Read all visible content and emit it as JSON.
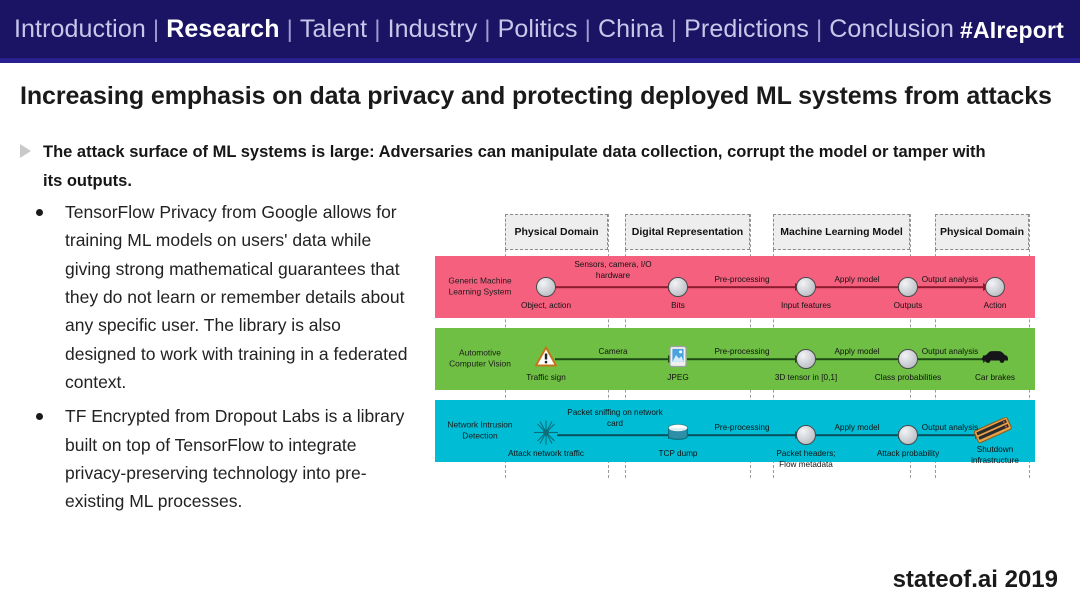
{
  "nav": {
    "items": [
      {
        "label": "Introduction",
        "active": false
      },
      {
        "label": "Research",
        "active": true
      },
      {
        "label": "Talent",
        "active": false
      },
      {
        "label": "Industry",
        "active": false
      },
      {
        "label": "Politics",
        "active": false
      },
      {
        "label": "China",
        "active": false
      },
      {
        "label": "Predictions",
        "active": false
      },
      {
        "label": "Conclusion",
        "active": false
      }
    ],
    "separator": "|",
    "hashtag": "#AIreport",
    "background_color": "#1b1464",
    "active_color": "#ffffff",
    "inactive_color": "#c9c6ea"
  },
  "slide": {
    "title": "Increasing emphasis on data privacy and protecting deployed ML systems from attacks",
    "lead": "The attack surface of ML systems is large: Adversaries can manipulate data collection, corrupt the model or tamper with its outputs.",
    "bullets": [
      "TensorFlow Privacy from Google allows for training ML models on users' data while giving strong mathematical guarantees that they do not learn or remember details about any specific user. The library is also designed to work with training in a federated context.",
      "TF Encrypted from Dropout Labs is a library built on top of TensorFlow to integrate privacy-preserving technology into pre-existing ML processes."
    ],
    "footer": "stateof.ai 2019"
  },
  "diagram": {
    "columns": [
      {
        "title": "Physical\nDomain"
      },
      {
        "title": "Digital\nRepresentation"
      },
      {
        "title": "Machine Learning\nModel"
      },
      {
        "title": "Physical\nDomain"
      }
    ],
    "column_titles": [
      "Physical Domain",
      "Digital Representation",
      "Machine Learning Model",
      "Physical Domain"
    ],
    "rows": [
      {
        "name": "Generic Machine Learning System",
        "color": "#f4607e",
        "nodes": [
          "Object, action",
          "Bits",
          "Input features",
          "Outputs",
          "Action"
        ],
        "edges": [
          "Sensors, camera, I/O hardware",
          "Pre-processing",
          "Apply model",
          "Output analysis"
        ],
        "icons": [
          "circle",
          "circle",
          "circle",
          "circle",
          "circle"
        ]
      },
      {
        "name": "Automotive Computer Vision",
        "color": "#6fbf44",
        "nodes": [
          "Traffic sign",
          "JPEG",
          "3D tensor in [0,1]",
          "Class probabilities",
          "Car brakes"
        ],
        "edges": [
          "Camera",
          "Pre-processing",
          "Apply model",
          "Output analysis"
        ],
        "icons": [
          "warning-sign",
          "image-file",
          "circle",
          "circle",
          "car"
        ]
      },
      {
        "name": "Network Intrusion Detection",
        "color": "#00bcd4",
        "nodes": [
          "Attack network traffic",
          "TCP dump",
          "Packet headers; Flow metadata",
          "Attack probability",
          "Shutdown infrastructure"
        ],
        "edges": [
          "Packet sniffing on network card",
          "Pre-processing",
          "Apply model",
          "Output analysis"
        ],
        "icons": [
          "network-burst",
          "database",
          "circle",
          "circle",
          "server-rack"
        ]
      }
    ]
  }
}
